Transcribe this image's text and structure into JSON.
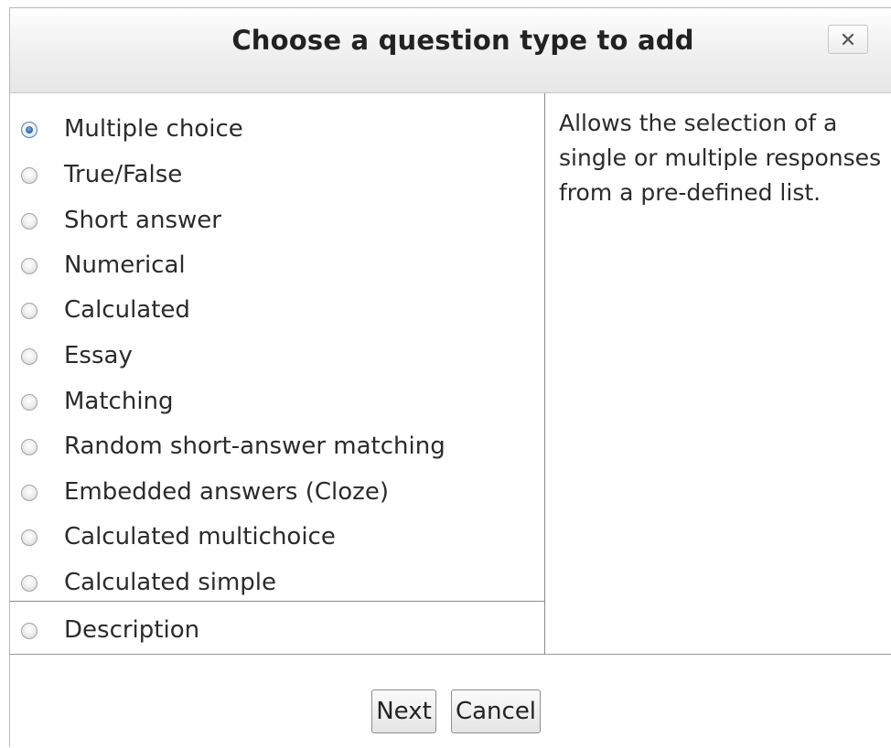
{
  "dialog": {
    "title": "Choose a question type to add",
    "close_icon": "close-x-icon"
  },
  "question_types": [
    {
      "label": "Multiple choice",
      "selected": true
    },
    {
      "label": "True/False",
      "selected": false
    },
    {
      "label": "Short answer",
      "selected": false
    },
    {
      "label": "Numerical",
      "selected": false
    },
    {
      "label": "Calculated",
      "selected": false
    },
    {
      "label": "Essay",
      "selected": false
    },
    {
      "label": "Matching",
      "selected": false
    },
    {
      "label": "Random short-answer matching",
      "selected": false
    },
    {
      "label": "Embedded answers (Cloze)",
      "selected": false
    },
    {
      "label": "Calculated multichoice",
      "selected": false
    },
    {
      "label": "Calculated simple",
      "selected": false
    },
    {
      "label": "Description",
      "selected": false
    }
  ],
  "description": {
    "text": "Allows the selection of a single or multiple responses from a pre-defined list."
  },
  "footer": {
    "next_label": "Next",
    "cancel_label": "Cancel"
  },
  "colors": {
    "radio_selected": "#2f61a8",
    "header_gradient_bottom": "#e6e6e6"
  }
}
